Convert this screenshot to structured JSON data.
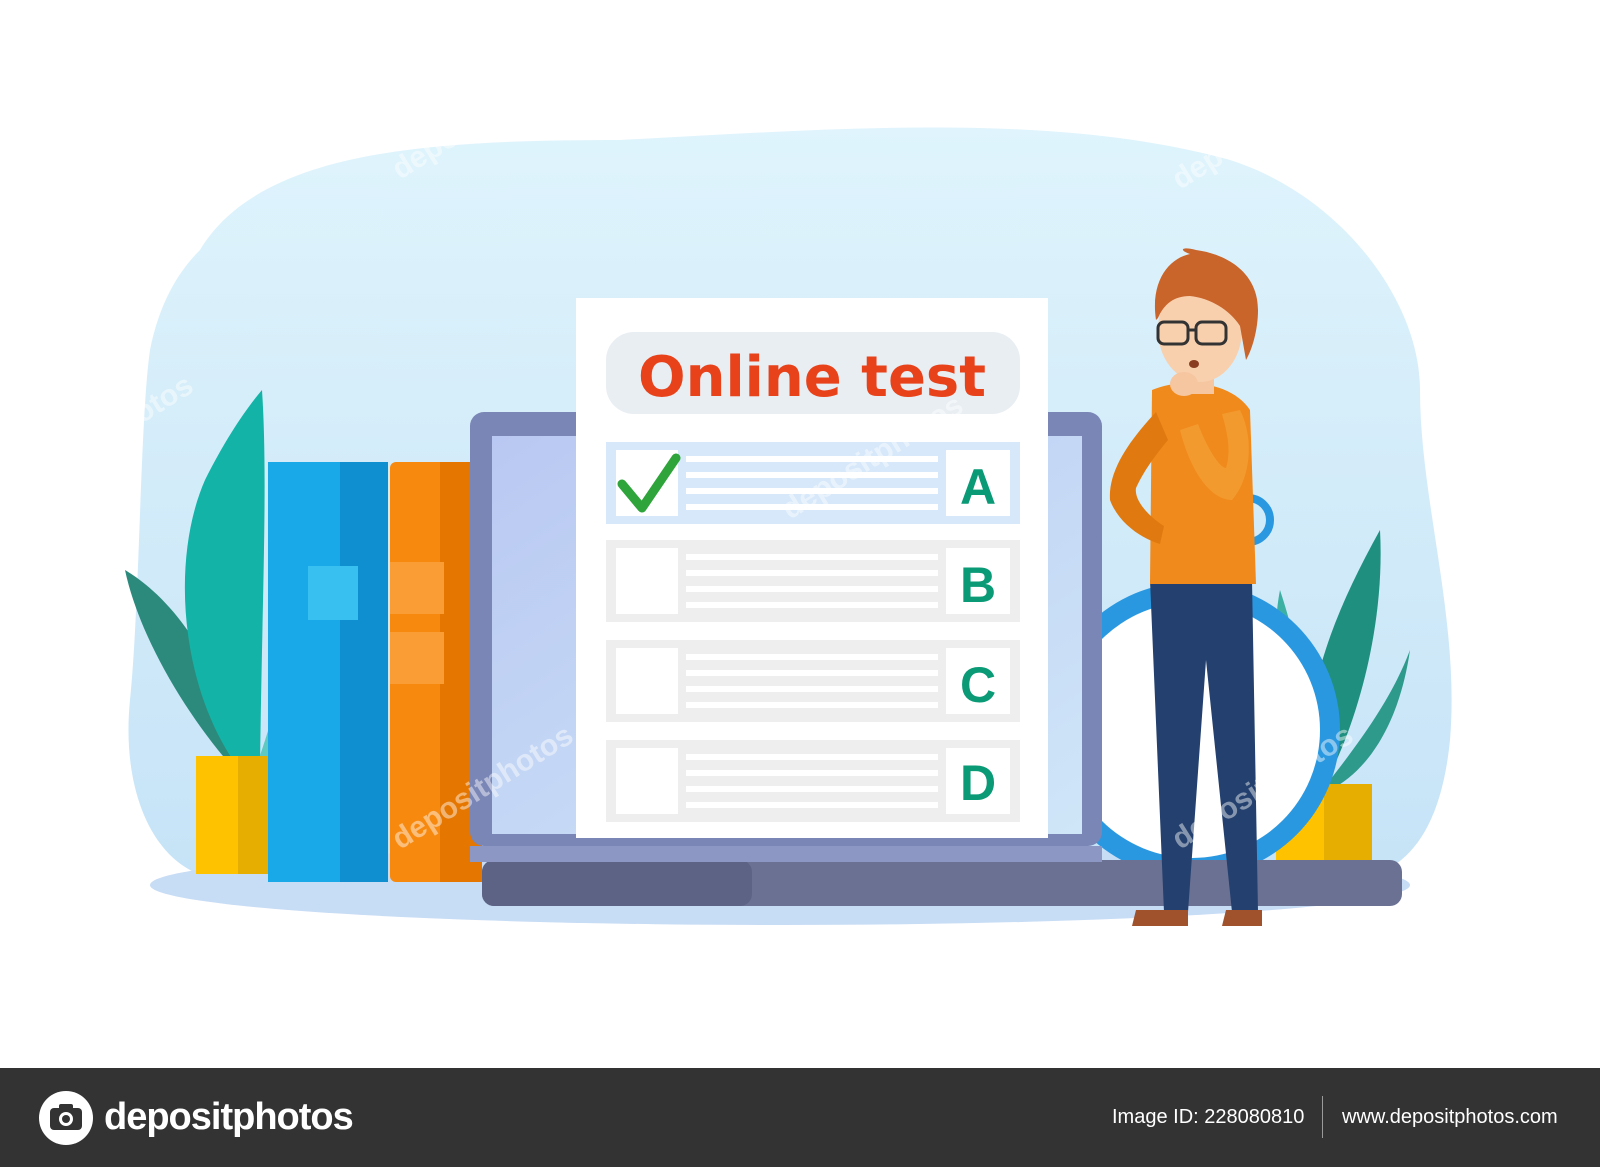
{
  "test": {
    "title": "Online test",
    "options": [
      "A",
      "B",
      "C",
      "D"
    ],
    "selected_option": "A"
  },
  "watermark": {
    "text": "depositphotos"
  },
  "footer": {
    "brand": "depositphotos",
    "image_id": "Image ID: 228080810",
    "website": "www.depositphotos.com"
  },
  "colors": {
    "title_red": "#e8421b",
    "option_green": "#0a9a76",
    "check_green": "#2ea43a",
    "blob_blue": "#d4eefb",
    "footer_bg": "#333333",
    "shirt_orange": "#f08a1c",
    "pants_navy": "#23406e"
  },
  "icons": [
    "checkmark-icon",
    "camera-logo-icon"
  ]
}
